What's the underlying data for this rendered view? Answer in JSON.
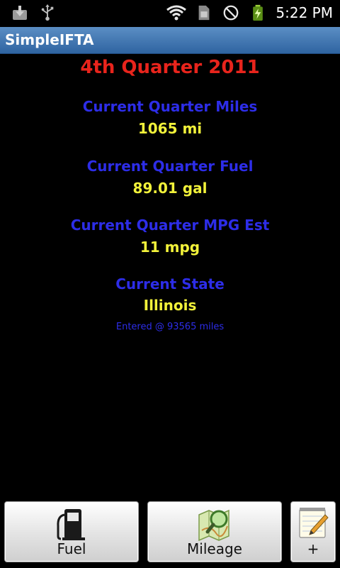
{
  "status": {
    "time": "5:22 PM",
    "icons": [
      "download-icon",
      "usb-icon",
      "wifi-icon",
      "sim-icon",
      "no-signal-icon",
      "battery-charging-icon"
    ]
  },
  "app": {
    "title": "SimpleIFTA"
  },
  "main": {
    "quarter": "4th Quarter 2011",
    "miles_label": "Current Quarter Miles",
    "miles_value": "1065 mi",
    "fuel_label": "Current Quarter Fuel",
    "fuel_value": "89.01 gal",
    "mpg_label": "Current Quarter MPG Est",
    "mpg_value": "11 mpg",
    "state_label": "Current State",
    "state_value": "Illinois",
    "entered_note": "Entered @ 93565 miles"
  },
  "buttons": {
    "fuel": "Fuel",
    "mileage": "Mileage",
    "add": "+"
  },
  "colors": {
    "quarter": "#e8241c",
    "label": "#2d2de8",
    "value": "#f2f23a",
    "titlebar": "#3a6fae"
  }
}
